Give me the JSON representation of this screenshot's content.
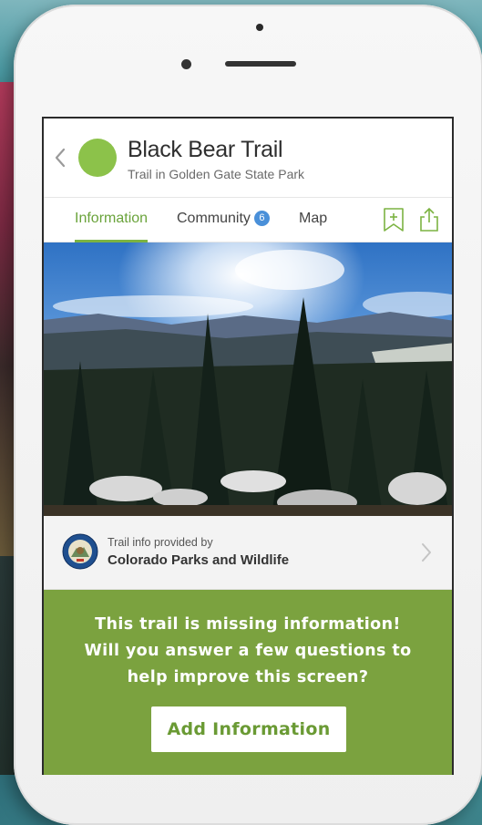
{
  "colors": {
    "accent_green": "#7cb342",
    "cta_green": "#7ba23f",
    "trail_dot": "#8cc24a",
    "badge_blue": "#4a90d9"
  },
  "header": {
    "back_icon": "chevron-left-icon",
    "title": "Black Bear Trail",
    "subtitle": "Trail in Golden Gate State Park"
  },
  "tabs": {
    "information": "Information",
    "community": "Community",
    "community_count": "6",
    "map": "Map",
    "bookmark_icon": "bookmark-add-icon",
    "share_icon": "share-icon"
  },
  "provider": {
    "caption": "Trail info provided by",
    "name": "Colorado Parks and Wildlife",
    "logo_text": "COLORADO PARKS & WILDLIFE",
    "chevron_icon": "chevron-right-icon"
  },
  "cta": {
    "line1": "This trail is missing information!",
    "line2": "Will you answer a few questions to",
    "line3": "help improve this screen?",
    "button": "Add Information"
  }
}
